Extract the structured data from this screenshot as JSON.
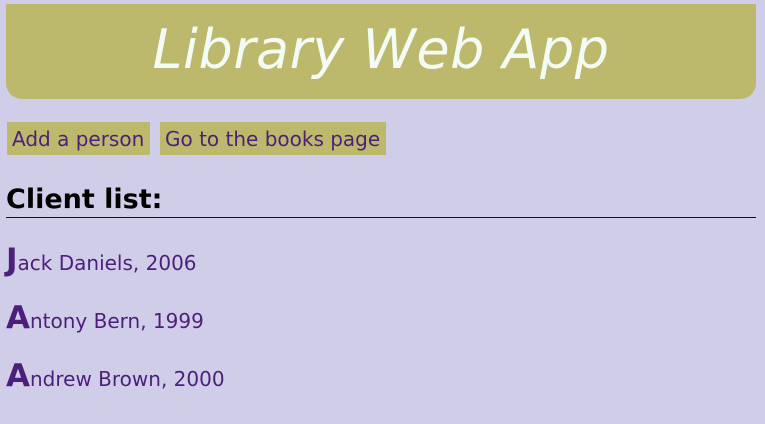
{
  "header": {
    "title": "Library Web App"
  },
  "nav": {
    "add_person_label": "Add a person",
    "books_page_label": "Go to the books page"
  },
  "clients": {
    "heading": "Client list:",
    "items": [
      "Jack Daniels, 2006",
      "Antony Bern, 1999",
      "Andrew Brown, 2000"
    ]
  },
  "colors": {
    "background": "#cfcde8",
    "accent": "#bcb96c",
    "link_text": "#4d1f7a",
    "header_text": "#f3fbf5"
  }
}
